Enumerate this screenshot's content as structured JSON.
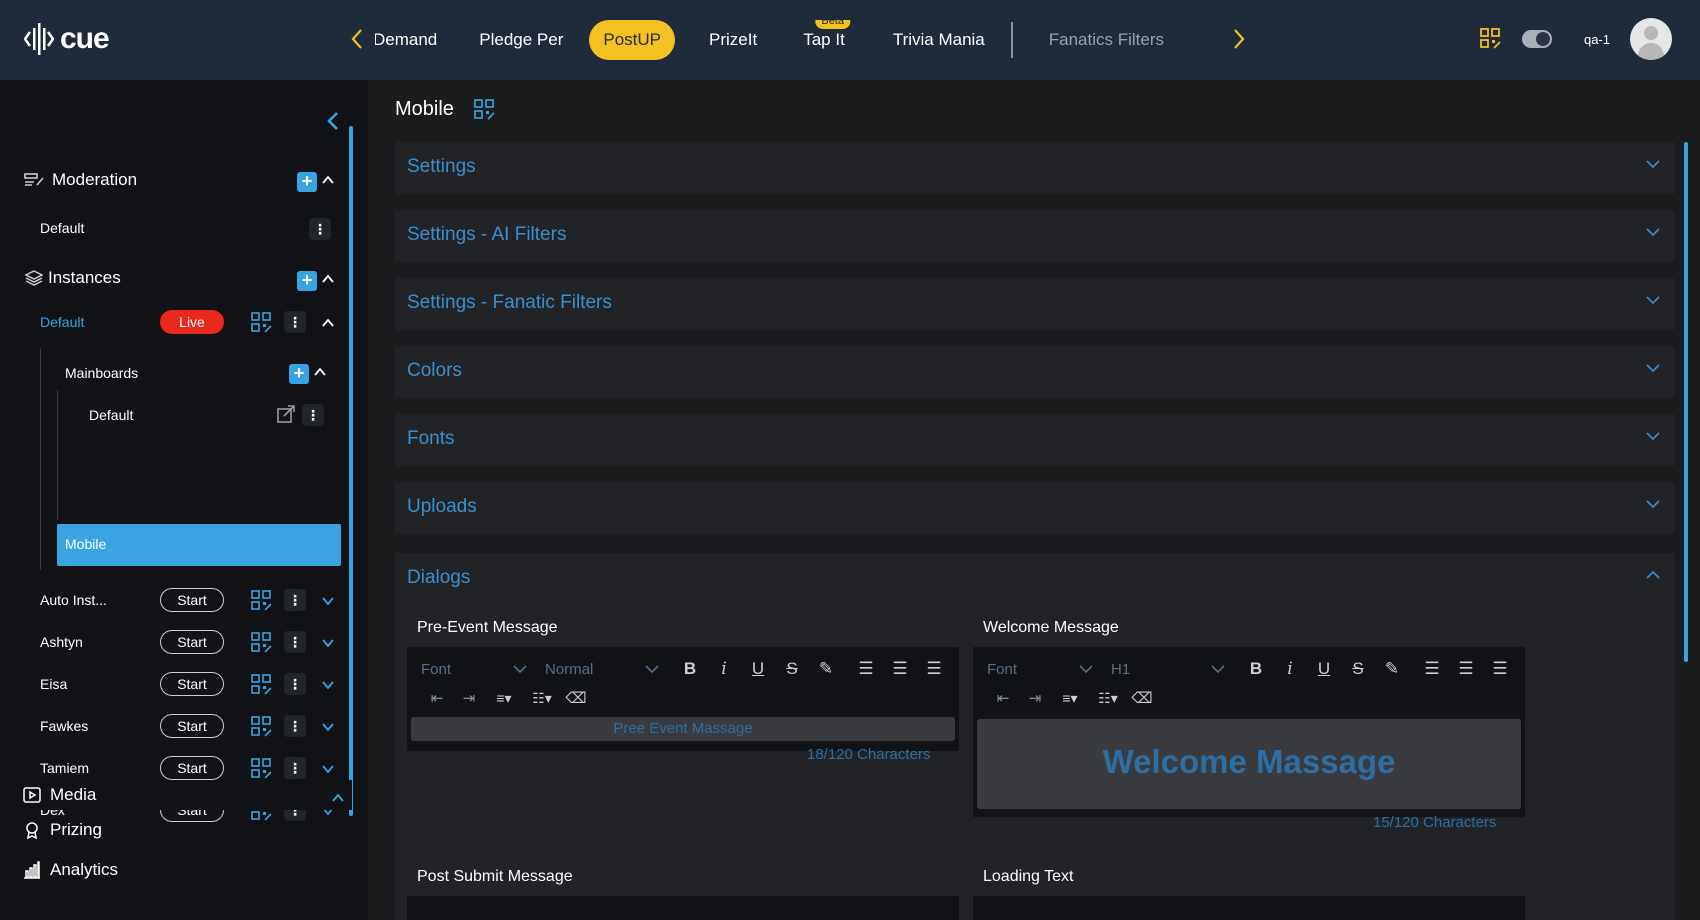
{
  "app": {
    "logo_text": "cue"
  },
  "nav": {
    "tabs": [
      {
        "label": "Demand",
        "state": "normal"
      },
      {
        "label": "Pledge Per",
        "state": "normal"
      },
      {
        "label": "PostUP",
        "state": "active"
      },
      {
        "label": "PrizeIt",
        "state": "normal"
      },
      {
        "label": "Tap It",
        "state": "normal",
        "badge": "Beta"
      },
      {
        "label": "Trivia Mania",
        "state": "normal"
      },
      {
        "label": "Fanatics Filters",
        "state": "muted"
      }
    ]
  },
  "user": {
    "name": "qa-1"
  },
  "sidebar": {
    "moderation": {
      "label": "Moderation",
      "items": [
        {
          "label": "Default"
        }
      ]
    },
    "instances": {
      "label": "Instances",
      "default_instance": {
        "label": "Default",
        "status": "Live"
      },
      "mainboards": {
        "label": "Mainboards",
        "items": [
          {
            "label": "Default"
          }
        ]
      },
      "mobile": {
        "label": "Mobile"
      },
      "others": [
        {
          "label": "Auto Inst...",
          "action": "Start"
        },
        {
          "label": "Ashtyn",
          "action": "Start"
        },
        {
          "label": "Eisa",
          "action": "Start"
        },
        {
          "label": "Fawkes",
          "action": "Start"
        },
        {
          "label": "Tamiem",
          "action": "Start"
        },
        {
          "label": "Dex",
          "action": "Start"
        }
      ]
    },
    "media": {
      "label": "Media"
    },
    "prizing": {
      "label": "Prizing"
    },
    "analytics": {
      "label": "Analytics"
    }
  },
  "main": {
    "title": "Mobile",
    "accordions": [
      {
        "label": "Settings"
      },
      {
        "label": "Settings - AI Filters"
      },
      {
        "label": "Settings - Fanatic Filters"
      },
      {
        "label": "Colors"
      },
      {
        "label": "Fonts"
      },
      {
        "label": "Uploads"
      }
    ],
    "dialogs": {
      "label": "Dialogs",
      "pre_event": {
        "label": "Pre-Event Message",
        "font": "Font",
        "size": "Normal",
        "content": "Pree Event Massage",
        "count": "18/120 Characters"
      },
      "welcome": {
        "label": "Welcome Message",
        "font": "Font",
        "size": "H1",
        "content": "Welcome Massage",
        "count": "15/120 Characters"
      },
      "post_submit": {
        "label": "Post Submit Message"
      },
      "loading": {
        "label": "Loading Text"
      }
    }
  },
  "colors": {
    "accent": "#3aa3e2",
    "active_tab": "#f3c122",
    "live": "#e8291c"
  }
}
